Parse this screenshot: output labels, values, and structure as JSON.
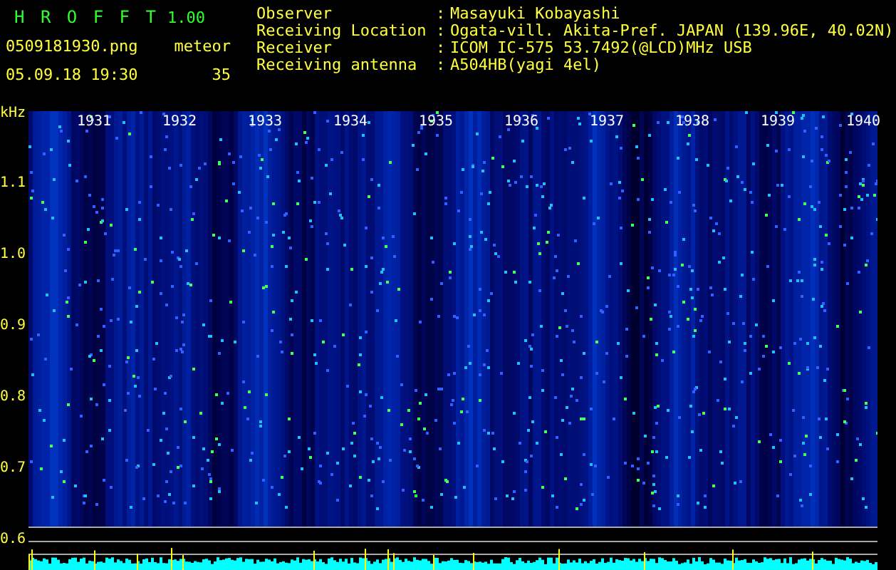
{
  "app": {
    "title": "H R O F F T",
    "version": "1.00"
  },
  "file": {
    "name": "0509181930.png",
    "datetime": "05.09.18 19:30"
  },
  "meteor": {
    "label": "meteor",
    "count": "35"
  },
  "info": [
    {
      "label": "Observer",
      "separator": ":",
      "value": "Masayuki Kobayashi"
    },
    {
      "label": "Receiving Location",
      "separator": ":",
      "value": "Ogata-vill. Akita-Pref. JAPAN (139.96E, 40.02N)"
    },
    {
      "label": "Receiver",
      "separator": ":",
      "value": "ICOM IC-575 53.7492(@LCD)MHz USB"
    },
    {
      "label": "Receiving antenna",
      "separator": ":",
      "value": "A504HB(yagi 4el)"
    }
  ],
  "axis": {
    "unit": "kHz",
    "ticks": [
      "1.1",
      "1.0",
      "0.9",
      "0.8",
      "0.7",
      "0.6"
    ]
  },
  "time_labels": [
    "1931",
    "1932",
    "1933",
    "1934",
    "1935",
    "1936",
    "1937",
    "1938",
    "1939",
    "1940"
  ]
}
